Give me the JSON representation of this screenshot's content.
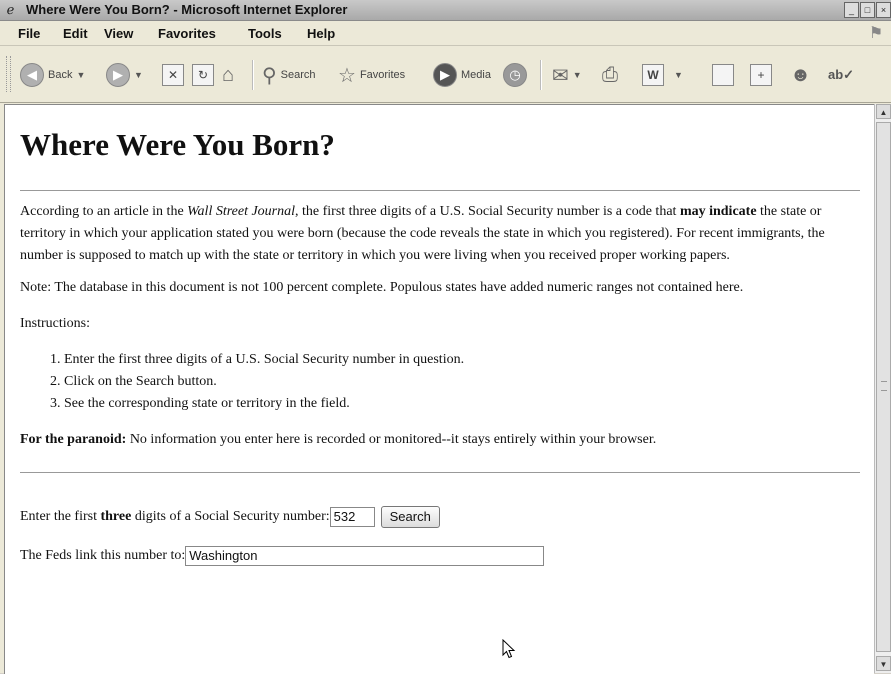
{
  "window": {
    "title": "Where Were You Born? - Microsoft Internet Explorer",
    "controls": [
      "minimize",
      "maximize",
      "close"
    ]
  },
  "menu": [
    "File",
    "Edit",
    "View",
    "Favorites",
    "Tools",
    "Help"
  ],
  "toolbar": {
    "back_label": "Back",
    "search_label": "Search",
    "favorites_label": "Favorites",
    "media_label": "Media"
  },
  "page": {
    "heading": "Where Were You Born?",
    "intro": {
      "part1": "According to an article in the ",
      "source": "Wall Street Journal",
      "part2": ", the first three digits of a U.S. Social Security number is a code that ",
      "emphasis": "may indicate",
      "part3": " the state or territory in which your application stated you were born (because the code reveals the state in which you registered). For recent immigrants, the number is supposed to match up with the state or territory in which you were living when you received proper working papers."
    },
    "note": "Note: The database in this document is not 100 percent complete. Populous states have added numeric ranges not contained here.",
    "instructions_label": "Instructions:",
    "steps": [
      "Enter the first three digits of a U.S. Social Security number in question.",
      "Click on the Search button.",
      "See the corresponding state or territory in the field."
    ],
    "paranoid_label": "For the paranoid:",
    "paranoid_text": " No information you enter here is recorded or monitored--it stays entirely within your browser.",
    "form": {
      "prompt_part1": "Enter the first ",
      "prompt_bold": "three",
      "prompt_part2": " digits of a Social Security number:",
      "ssn_value": "532",
      "search_button": "Search",
      "result_label": "The Feds link this number to:",
      "result_value": "Washington"
    }
  }
}
